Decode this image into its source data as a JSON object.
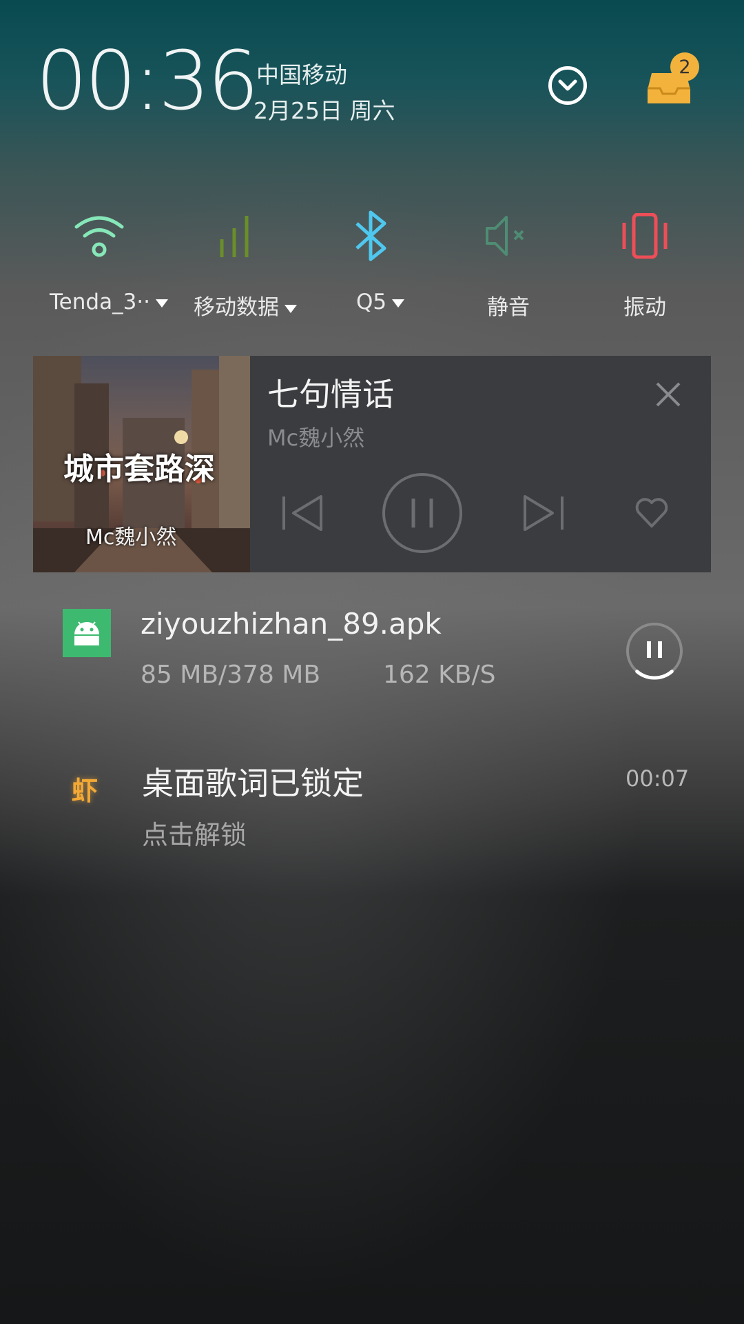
{
  "header": {
    "time": "00:36",
    "carrier": "中国移动",
    "date": "2月25日  周六",
    "badge_count": "2",
    "icons": {
      "collapse": "chevron-down-circle-icon",
      "inbox": "inbox-tray-icon"
    }
  },
  "quick_settings": [
    {
      "label": "Tenda_3··",
      "icon": "wifi-icon",
      "color": "#86e7b8",
      "has_dropdown": true
    },
    {
      "label": "移动数据",
      "icon": "cellular-signal-icon",
      "color": "#6a8e2a",
      "has_dropdown": true
    },
    {
      "label": "Q5",
      "icon": "bluetooth-icon",
      "color": "#4fc8f0",
      "has_dropdown": true
    },
    {
      "label": "静音",
      "icon": "mute-icon",
      "color": "#4f8c74",
      "has_dropdown": false
    },
    {
      "label": "振动",
      "icon": "vibrate-icon",
      "color": "#ee4e58",
      "has_dropdown": false
    }
  ],
  "music": {
    "album_title": "城市套路深",
    "album_artist": "Mc魏小然",
    "song_title": "七句情话",
    "artist": "Mc魏小然",
    "controls": [
      "previous-icon",
      "pause-icon",
      "next-icon",
      "heart-icon"
    ]
  },
  "download": {
    "filename": "ziyouzhizhan_89.apk",
    "progress": "85  MB/378  MB",
    "speed": "162  KB/S",
    "downloaded_mb": 85,
    "total_mb": 378,
    "icon": "android-icon"
  },
  "lyrics": {
    "icon_glyph": "虾",
    "title": "桌面歌词已锁定",
    "subtitle": "点击解锁",
    "time": "00:07"
  },
  "colors": {
    "accent_badge": "#f3b23c",
    "apk_green": "#3dba6f",
    "music_card": "#3b3c3f"
  }
}
